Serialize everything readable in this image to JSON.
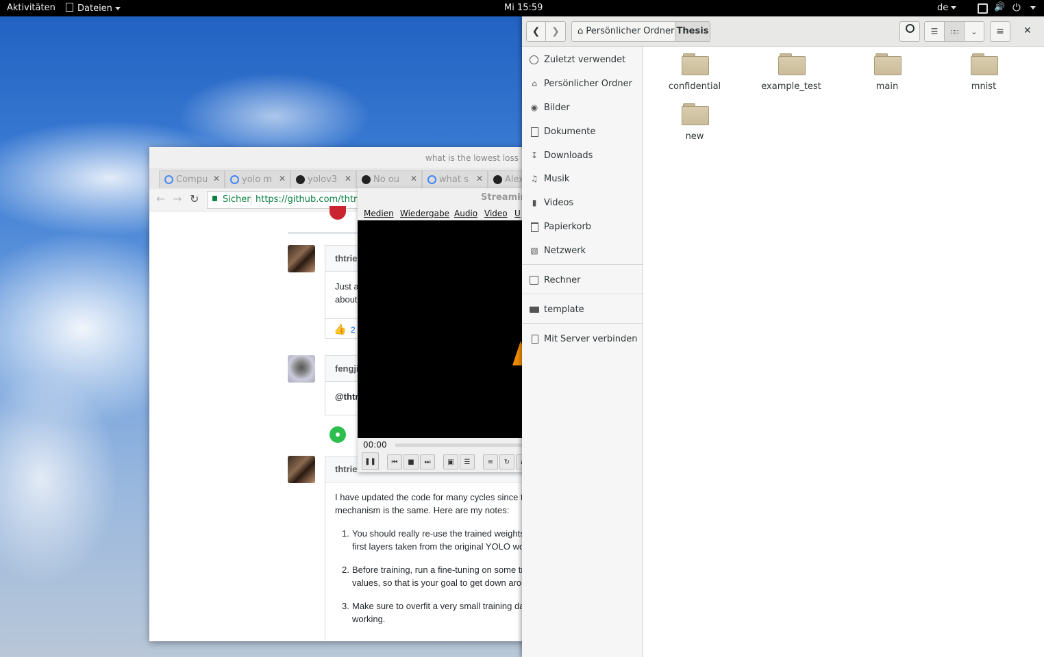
{
  "topbar": {
    "activities": "Aktivitäten",
    "app_menu": "Dateien",
    "clock": "Mi 15:59",
    "keyboard_layout": "de"
  },
  "chrome": {
    "window_title": "what is the lowest loss",
    "tabs": [
      {
        "label": "Compu",
        "icon": "globe-icon",
        "color": "#4a8af4"
      },
      {
        "label": "yolo m",
        "icon": "google-icon",
        "color": "#4285f4"
      },
      {
        "label": "yolov3",
        "icon": "github-icon",
        "color": "#222222"
      },
      {
        "label": "No ou",
        "icon": "github-icon",
        "color": "#222222"
      },
      {
        "label": "what s",
        "icon": "google-icon",
        "color": "#4285f4"
      },
      {
        "label": "Alex",
        "icon": "github-icon",
        "color": "#222222"
      }
    ],
    "secure_label": "Sicher",
    "url": "https://github.com/thtrieu",
    "comments": {
      "c1_author": "thtrie",
      "c1_text_1": "Just a",
      "c1_text_2": "about",
      "c1_reaction_count": "2",
      "c2_author": "fengji",
      "c2_text": "@thtr",
      "c3_author": "thtrieu",
      "c3_p1_line1": "I have updated the code for many cycles since th",
      "c3_p1_line2": "mechanism is the same. Here are my notes:",
      "items": [
        {
          "num": "1.",
          "line1": "You should really re-use the trained weights,",
          "line2": "first layers taken from the original YOLO wou"
        },
        {
          "num": "2.",
          "line1": "Before training, run a fine-tuning on some tra",
          "line2": "values, so that is your goal to get down arou"
        },
        {
          "num": "3.",
          "line1": "Make sure to overfit a very small training dat",
          "line2": "working."
        }
      ]
    }
  },
  "vlc": {
    "title": "Streaming",
    "menu": [
      "Medien",
      "Wiedergabe",
      "Audio",
      "Video",
      "U"
    ],
    "time": "00:00",
    "progress_fraction": 0
  },
  "files": {
    "breadcrumb_home": "Persönlicher Ordner",
    "breadcrumb_current": "Thesis",
    "sidebar": [
      {
        "label": "Zuletzt verwendet",
        "icon": "clock-icon"
      },
      {
        "label": "Persönlicher Ordner",
        "icon": "home-icon"
      },
      {
        "label": "Bilder",
        "icon": "camera-icon"
      },
      {
        "label": "Dokumente",
        "icon": "document-icon"
      },
      {
        "label": "Downloads",
        "icon": "download-icon"
      },
      {
        "label": "Musik",
        "icon": "music-icon"
      },
      {
        "label": "Videos",
        "icon": "video-icon"
      },
      {
        "label": "Papierkorb",
        "icon": "trash-icon"
      },
      {
        "label": "Netzwerk",
        "icon": "network-icon"
      }
    ],
    "computer": "Rechner",
    "bookmark": "template",
    "connect": "Mit Server verbinden",
    "folders": [
      "confidential",
      "example_test",
      "main",
      "mnist",
      "new"
    ]
  }
}
